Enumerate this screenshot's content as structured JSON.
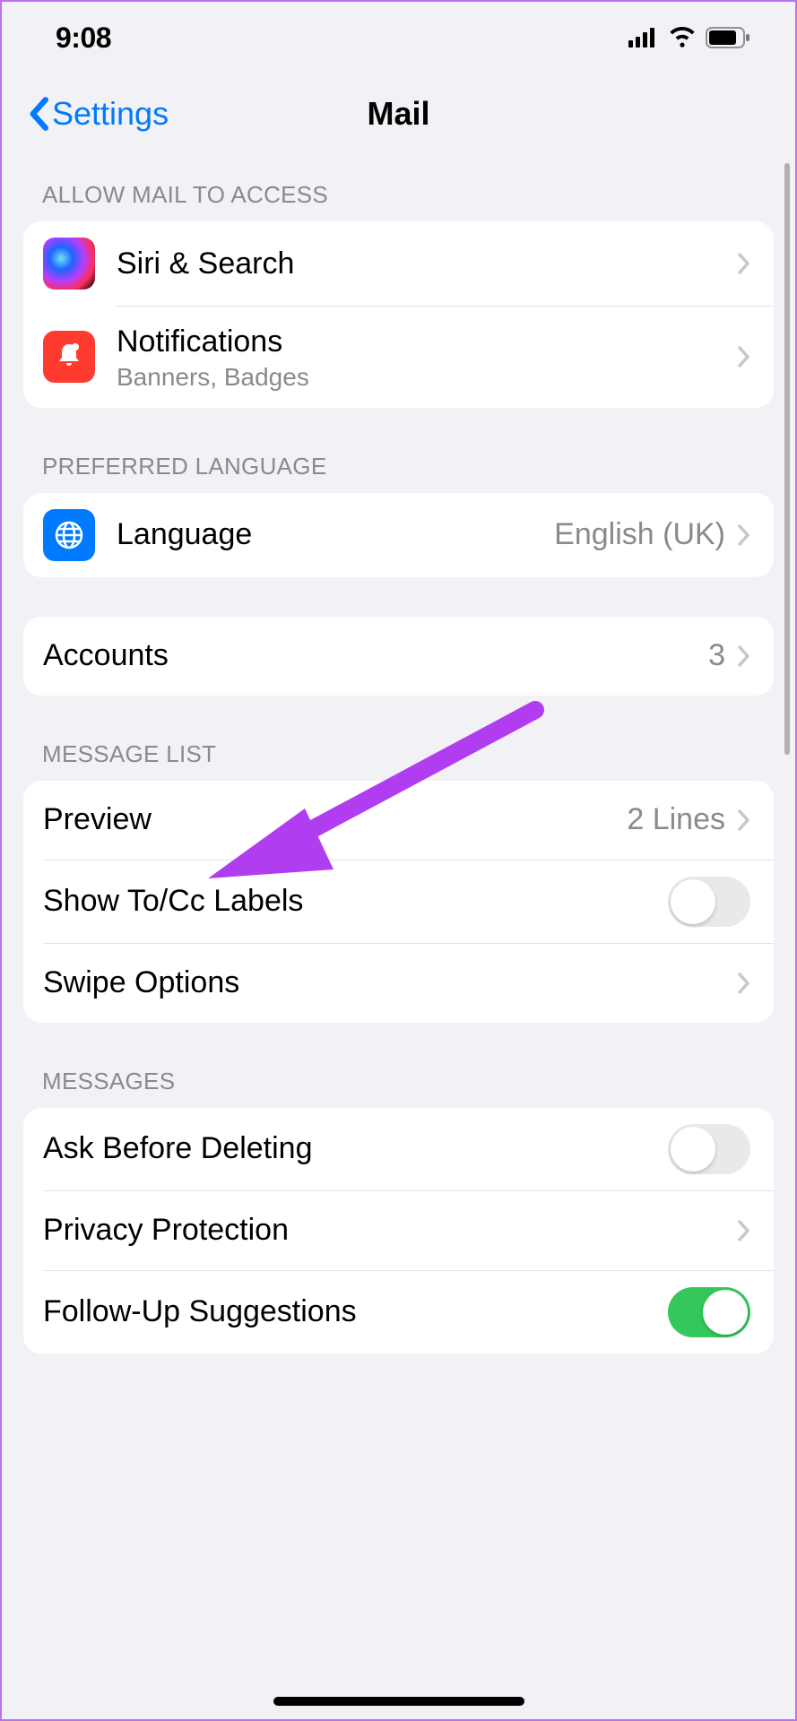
{
  "status": {
    "time": "9:08"
  },
  "nav": {
    "back": "Settings",
    "title": "Mail"
  },
  "sections": {
    "access": {
      "header": "Allow Mail to Access",
      "siri": "Siri & Search",
      "notifications": {
        "title": "Notifications",
        "sub": "Banners, Badges"
      }
    },
    "language": {
      "header": "Preferred Language",
      "row": {
        "title": "Language",
        "value": "English (UK)"
      }
    },
    "accounts": {
      "title": "Accounts",
      "value": "3"
    },
    "messageList": {
      "header": "Message List",
      "preview": {
        "title": "Preview",
        "value": "2 Lines"
      },
      "tocc": "Show To/Cc Labels",
      "swipe": "Swipe Options"
    },
    "messages": {
      "header": "Messages",
      "askDelete": "Ask Before Deleting",
      "privacy": "Privacy Protection",
      "followUp": "Follow-Up Suggestions"
    }
  }
}
